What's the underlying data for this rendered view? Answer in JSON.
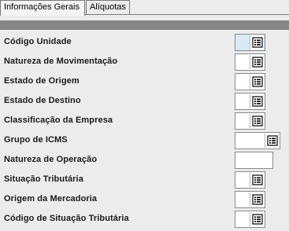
{
  "tabs": [
    {
      "label": "Informações Gerais",
      "active": true
    },
    {
      "label": "Alíquotas",
      "active": false
    }
  ],
  "fields": [
    {
      "label": "Código Unidade",
      "control": "lookup",
      "highlighted": true
    },
    {
      "label": "Natureza de Movimentação",
      "control": "lookup"
    },
    {
      "label": "Estado de Origem",
      "control": "lookup"
    },
    {
      "label": "Estado de Destino",
      "control": "lookup"
    },
    {
      "label": "Classificação da Empresa",
      "control": "lookup"
    },
    {
      "label": "Grupo de ICMS",
      "control": "lookup-wide"
    },
    {
      "label": "Natureza de Operação",
      "control": "text"
    },
    {
      "label": "Situação Tributária",
      "control": "lookup"
    },
    {
      "label": "Origem da Mercadoria",
      "control": "lookup"
    },
    {
      "label": "Código de Situação Tributária",
      "control": "lookup"
    }
  ],
  "icons": {
    "lookup_button": "list-lookup-icon"
  }
}
